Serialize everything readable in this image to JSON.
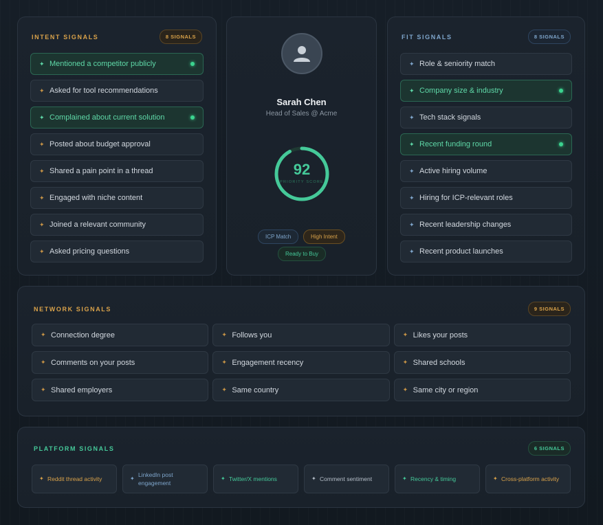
{
  "intent": {
    "title": "INTENT SIGNALS",
    "badge": "8 SIGNALS",
    "items": [
      {
        "label": "Mentioned a competitor publicly",
        "active": true
      },
      {
        "label": "Asked for tool recommendations",
        "active": false
      },
      {
        "label": "Complained about current solution",
        "active": true
      },
      {
        "label": "Posted about budget approval",
        "active": false
      },
      {
        "label": "Shared a pain point in a thread",
        "active": false
      },
      {
        "label": "Engaged with niche content",
        "active": false
      },
      {
        "label": "Joined a relevant community",
        "active": false
      },
      {
        "label": "Asked pricing questions",
        "active": false
      }
    ]
  },
  "profile": {
    "name": "Sarah Chen",
    "role": "Head of Sales @ Acme",
    "score": "92",
    "score_label": "PRIORITY SCORE",
    "score_fraction": 0.92,
    "tags": {
      "icp": "ICP Match",
      "high": "High Intent",
      "ready": "Ready to Buy"
    }
  },
  "fit": {
    "title": "FIT SIGNALS",
    "badge": "8 SIGNALS",
    "items": [
      {
        "label": "Role & seniority match",
        "active": false
      },
      {
        "label": "Company size & industry",
        "active": true
      },
      {
        "label": "Tech stack signals",
        "active": false
      },
      {
        "label": "Recent funding round",
        "active": true
      },
      {
        "label": "Active hiring volume",
        "active": false
      },
      {
        "label": "Hiring for ICP-relevant roles",
        "active": false
      },
      {
        "label": "Recent leadership changes",
        "active": false
      },
      {
        "label": "Recent product launches",
        "active": false
      }
    ]
  },
  "network": {
    "title": "NETWORK SIGNALS",
    "badge": "9 SIGNALS",
    "items": [
      "Connection degree",
      "Follows you",
      "Likes your posts",
      "Comments on your posts",
      "Engagement recency",
      "Shared schools",
      "Shared employers",
      "Same country",
      "Same city or region"
    ]
  },
  "platform": {
    "title": "PLATFORM SIGNALS",
    "badge": "6 SIGNALS",
    "items": [
      {
        "label": "Reddit thread activity",
        "tone": "amber"
      },
      {
        "label": "LinkedIn post engagement",
        "tone": "blue"
      },
      {
        "label": "Twitter/X mentions",
        "tone": "teal"
      },
      {
        "label": "Comment sentiment",
        "tone": "grey"
      },
      {
        "label": "Recency & timing",
        "tone": "teal"
      },
      {
        "label": "Cross-platform activity",
        "tone": "amber"
      }
    ]
  },
  "colors": {
    "amber": "#d9a24a",
    "blue": "#7fa6cc",
    "teal": "#45c999",
    "background": "#141b23"
  },
  "icons": {
    "star": "sparkle-icon",
    "avatar": "user-icon",
    "dot": "active-dot-icon"
  }
}
